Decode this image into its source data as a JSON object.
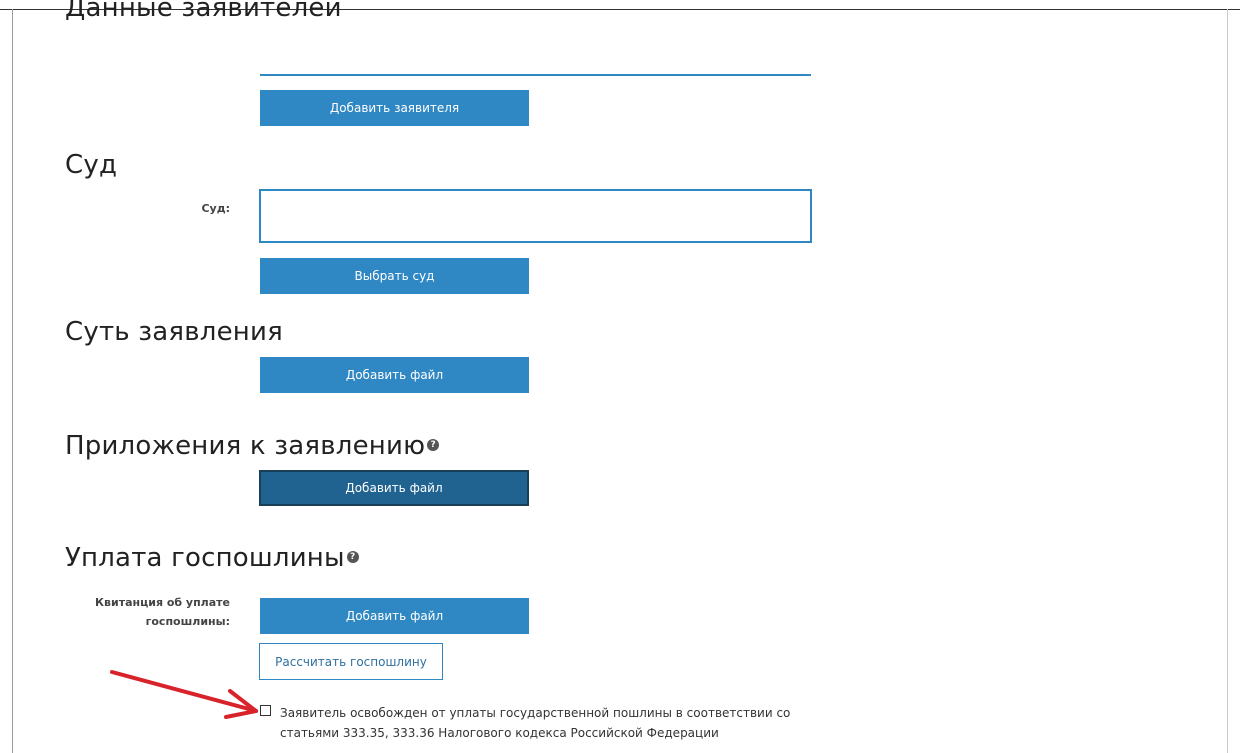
{
  "applicants": {
    "title": "Данные заявителей",
    "add_button": "Добавить заявителя"
  },
  "court": {
    "title": "Суд",
    "field_label": "Суд:",
    "field_value": "",
    "select_button": "Выбрать суд"
  },
  "essence": {
    "title": "Суть заявления",
    "add_file_button": "Добавить файл"
  },
  "attachments": {
    "title": "Приложения к заявлению",
    "help_icon": "question-circle-icon",
    "add_file_button": "Добавить файл"
  },
  "duty": {
    "title": "Уплата госпошлины",
    "help_icon": "question-circle-icon",
    "receipt_label": "Квитанция об уплате госпошлины:",
    "add_file_button": "Добавить файл",
    "calculate_button": "Рассчитать госпошлину",
    "exempt_checkbox_checked": false,
    "exempt_label": "Заявитель освобожден от уплаты государственной пошлины в соответствии со статьями 333.35, 333.36 Налогового кодекса Российской Федерации"
  },
  "colors": {
    "button_blue": "#2f87c3",
    "button_active": "#216390",
    "annotation_arrow": "#d8232a"
  }
}
